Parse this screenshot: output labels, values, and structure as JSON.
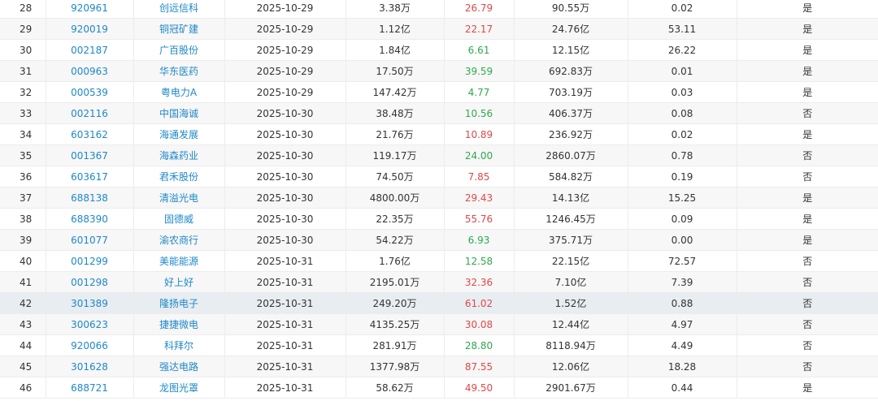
{
  "table": {
    "rows": [
      {
        "seq": "28",
        "code": "920961",
        "name": "创远信科",
        "date": "2025-10-29",
        "amount": "3.38万",
        "pe": "26.79",
        "trend": "up",
        "cap": "90.55万",
        "ratio": "0.02",
        "flag": "是"
      },
      {
        "seq": "29",
        "code": "920019",
        "name": "铜冠矿建",
        "date": "2025-10-29",
        "amount": "1.12亿",
        "pe": "22.17",
        "trend": "up",
        "cap": "24.76亿",
        "ratio": "53.11",
        "flag": "是"
      },
      {
        "seq": "30",
        "code": "002187",
        "name": "广百股份",
        "date": "2025-10-29",
        "amount": "1.84亿",
        "pe": "6.61",
        "trend": "down",
        "cap": "12.15亿",
        "ratio": "26.22",
        "flag": "是"
      },
      {
        "seq": "31",
        "code": "000963",
        "name": "华东医药",
        "date": "2025-10-29",
        "amount": "17.50万",
        "pe": "39.59",
        "trend": "down",
        "cap": "692.83万",
        "ratio": "0.01",
        "flag": "是"
      },
      {
        "seq": "32",
        "code": "000539",
        "name": "粤电力A",
        "date": "2025-10-29",
        "amount": "147.42万",
        "pe": "4.77",
        "trend": "down",
        "cap": "703.19万",
        "ratio": "0.03",
        "flag": "是"
      },
      {
        "seq": "33",
        "code": "002116",
        "name": "中国海诚",
        "date": "2025-10-30",
        "amount": "38.48万",
        "pe": "10.56",
        "trend": "down",
        "cap": "406.37万",
        "ratio": "0.08",
        "flag": "否"
      },
      {
        "seq": "34",
        "code": "603162",
        "name": "海通发展",
        "date": "2025-10-30",
        "amount": "21.76万",
        "pe": "10.89",
        "trend": "up",
        "cap": "236.92万",
        "ratio": "0.02",
        "flag": "是"
      },
      {
        "seq": "35",
        "code": "001367",
        "name": "海森药业",
        "date": "2025-10-30",
        "amount": "119.17万",
        "pe": "24.00",
        "trend": "down",
        "cap": "2860.07万",
        "ratio": "0.78",
        "flag": "否"
      },
      {
        "seq": "36",
        "code": "603617",
        "name": "君禾股份",
        "date": "2025-10-30",
        "amount": "74.50万",
        "pe": "7.85",
        "trend": "up",
        "cap": "584.82万",
        "ratio": "0.19",
        "flag": "否"
      },
      {
        "seq": "37",
        "code": "688138",
        "name": "清溢光电",
        "date": "2025-10-30",
        "amount": "4800.00万",
        "pe": "29.43",
        "trend": "up",
        "cap": "14.13亿",
        "ratio": "15.25",
        "flag": "是"
      },
      {
        "seq": "38",
        "code": "688390",
        "name": "固德威",
        "date": "2025-10-30",
        "amount": "22.35万",
        "pe": "55.76",
        "trend": "up",
        "cap": "1246.45万",
        "ratio": "0.09",
        "flag": "是"
      },
      {
        "seq": "39",
        "code": "601077",
        "name": "渝农商行",
        "date": "2025-10-30",
        "amount": "54.22万",
        "pe": "6.93",
        "trend": "down",
        "cap": "375.71万",
        "ratio": "0.00",
        "flag": "是"
      },
      {
        "seq": "40",
        "code": "001299",
        "name": "美能能源",
        "date": "2025-10-31",
        "amount": "1.76亿",
        "pe": "12.58",
        "trend": "down",
        "cap": "22.15亿",
        "ratio": "72.57",
        "flag": "否"
      },
      {
        "seq": "41",
        "code": "001298",
        "name": "好上好",
        "date": "2025-10-31",
        "amount": "2195.01万",
        "pe": "32.36",
        "trend": "up",
        "cap": "7.10亿",
        "ratio": "7.39",
        "flag": "否"
      },
      {
        "seq": "42",
        "code": "301389",
        "name": "隆扬电子",
        "date": "2025-10-31",
        "amount": "249.20万",
        "pe": "61.02",
        "trend": "up",
        "cap": "1.52亿",
        "ratio": "0.88",
        "flag": "否"
      },
      {
        "seq": "43",
        "code": "300623",
        "name": "捷捷微电",
        "date": "2025-10-31",
        "amount": "4135.25万",
        "pe": "30.08",
        "trend": "up",
        "cap": "12.44亿",
        "ratio": "4.97",
        "flag": "否"
      },
      {
        "seq": "44",
        "code": "920066",
        "name": "科拜尔",
        "date": "2025-10-31",
        "amount": "281.91万",
        "pe": "28.80",
        "trend": "down",
        "cap": "8118.94万",
        "ratio": "4.49",
        "flag": "否"
      },
      {
        "seq": "45",
        "code": "301628",
        "name": "强达电路",
        "date": "2025-10-31",
        "amount": "1377.98万",
        "pe": "87.55",
        "trend": "up",
        "cap": "12.06亿",
        "ratio": "18.28",
        "flag": "否"
      },
      {
        "seq": "46",
        "code": "688721",
        "name": "龙图光罩",
        "date": "2025-10-31",
        "amount": "58.62万",
        "pe": "49.50",
        "trend": "up",
        "cap": "2901.67万",
        "ratio": "0.44",
        "flag": "是"
      }
    ],
    "highlighted_row": "42",
    "colors": {
      "link": "#1e88c8",
      "up": "#e04848",
      "down": "#2fa84f",
      "highlight": "#e8edf1"
    }
  }
}
